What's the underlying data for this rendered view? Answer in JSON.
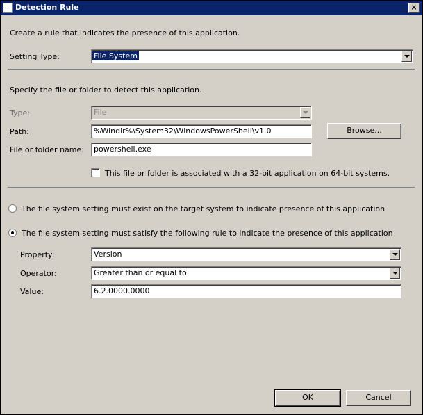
{
  "window": {
    "title": "Detection Rule",
    "close_label": "×"
  },
  "intro": "Create a rule that indicates the presence of this application.",
  "setting_type": {
    "label": "Setting Type:",
    "value": "File System"
  },
  "file_section": {
    "instruction": "Specify the file or folder to detect this application.",
    "type_label": "Type:",
    "type_value": "File",
    "path_label": "Path:",
    "path_value": "%Windir%\\System32\\WindowsPowerShell\\v1.0",
    "browse_label": "Browse...",
    "name_label": "File or folder name:",
    "name_value": "powershell.exe",
    "checkbox_label": "This file or folder is associated with a 32-bit application on 64-bit systems.",
    "checkbox_checked": false
  },
  "options": {
    "exist_label": "The file system setting must exist on the target system to indicate presence of this application",
    "exist_selected": false,
    "rule_label": "The file system setting must satisfy the following rule to indicate the presence of this application",
    "rule_selected": true
  },
  "rule": {
    "property_label": "Property:",
    "property_value": "Version",
    "operator_label": "Operator:",
    "operator_value": "Greater than or equal to",
    "value_label": "Value:",
    "value_value": "6.2.0000.0000"
  },
  "footer": {
    "ok_label": "OK",
    "cancel_label": "Cancel"
  }
}
